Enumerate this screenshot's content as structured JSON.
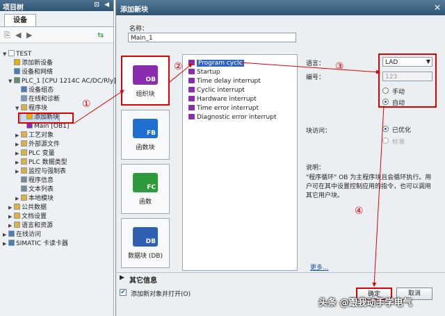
{
  "left_panel": {
    "title": "项目树",
    "controls": "⊡ ◀",
    "tab": "设备",
    "tree": [
      {
        "label": "TEST",
        "arrow": "▼",
        "color": "#ffffff"
      },
      {
        "label": "添加新设备",
        "arrow": "",
        "color": "#e9b000"
      },
      {
        "label": "设备和网络",
        "arrow": "",
        "color": "#4a7fb5"
      },
      {
        "label": "PLC_1 [CPU 1214C AC/DC/Rly]",
        "arrow": "▼",
        "color": "#6a8a6a"
      },
      {
        "label": "设备组态",
        "arrow": "",
        "color": "#4a7fb5"
      },
      {
        "label": "在线和诊断",
        "arrow": "",
        "color": "#7a9ac0"
      },
      {
        "label": "程序块",
        "arrow": "▼",
        "color": "#e0b040"
      },
      {
        "label": "添加新块",
        "arrow": "",
        "color": "#e9b000"
      },
      {
        "label": "Main [OB1]",
        "arrow": "",
        "color": "#8a2bb0"
      },
      {
        "label": "工艺对象",
        "arrow": "▶",
        "color": "#e0b040"
      },
      {
        "label": "外部源文件",
        "arrow": "▶",
        "color": "#e0b040"
      },
      {
        "label": "PLC 变量",
        "arrow": "▶",
        "color": "#e0b040"
      },
      {
        "label": "PLC 数据类型",
        "arrow": "▶",
        "color": "#e0b040"
      },
      {
        "label": "监控与强制表",
        "arrow": "▶",
        "color": "#e0b040"
      },
      {
        "label": "程序信息",
        "arrow": "",
        "color": "#7a8a99"
      },
      {
        "label": "文本列表",
        "arrow": "",
        "color": "#7a8a99"
      },
      {
        "label": "本地模块",
        "arrow": "▶",
        "color": "#e0b040"
      },
      {
        "label": "公共数据",
        "arrow": "▶",
        "color": "#e0b040"
      },
      {
        "label": "文档设置",
        "arrow": "▶",
        "color": "#e0b040"
      },
      {
        "label": "语言和资源",
        "arrow": "▶",
        "color": "#e0b040"
      },
      {
        "label": "在线访问",
        "arrow": "▶",
        "color": "#4a7fb5"
      },
      {
        "label": "SIMATIC 卡读卡器",
        "arrow": "▶",
        "color": "#4a7fb5"
      }
    ]
  },
  "dialog": {
    "title": "添加新块",
    "close": "✕",
    "name_label": "名称：",
    "name_value": "Main_1",
    "categories": [
      {
        "label": "组织块",
        "tag": "OB",
        "color": "#8a2bb0"
      },
      {
        "label": "函数块",
        "tag": "FB",
        "color": "#1f6fd0"
      },
      {
        "label": "函数",
        "tag": "FC",
        "color": "#2e9a3a"
      },
      {
        "label": "数据块 (DB)",
        "tag": "DB",
        "color": "#2f5fb0"
      }
    ],
    "events": [
      "Program cycle",
      "Startup",
      "Time delay interrupt",
      "Cyclic interrupt",
      "Hardware interrupt",
      "Time error interrupt",
      "Diagnostic error interrupt"
    ],
    "lang_label": "语言：",
    "lang_value": "LAD",
    "num_label": "编号：",
    "num_value": "123",
    "manual": "手动",
    "auto": "自动",
    "access_label": "块访问：",
    "optimized": "已优化",
    "standard": "标准",
    "desc_label": "说明：",
    "desc_text": "\"程序循环\" OB 为主程序块且会循环执行。用户可在其中设置控制应用的指令，也可以调用其它用户块。",
    "more": "更多...",
    "more_info": "其它信息",
    "open_after": "添加新对象并打开(O)",
    "ok": "确定",
    "cancel": "取消"
  },
  "annotations": [
    "①",
    "②",
    "③",
    "④"
  ],
  "watermark": "头条 @跟我动手学电气"
}
